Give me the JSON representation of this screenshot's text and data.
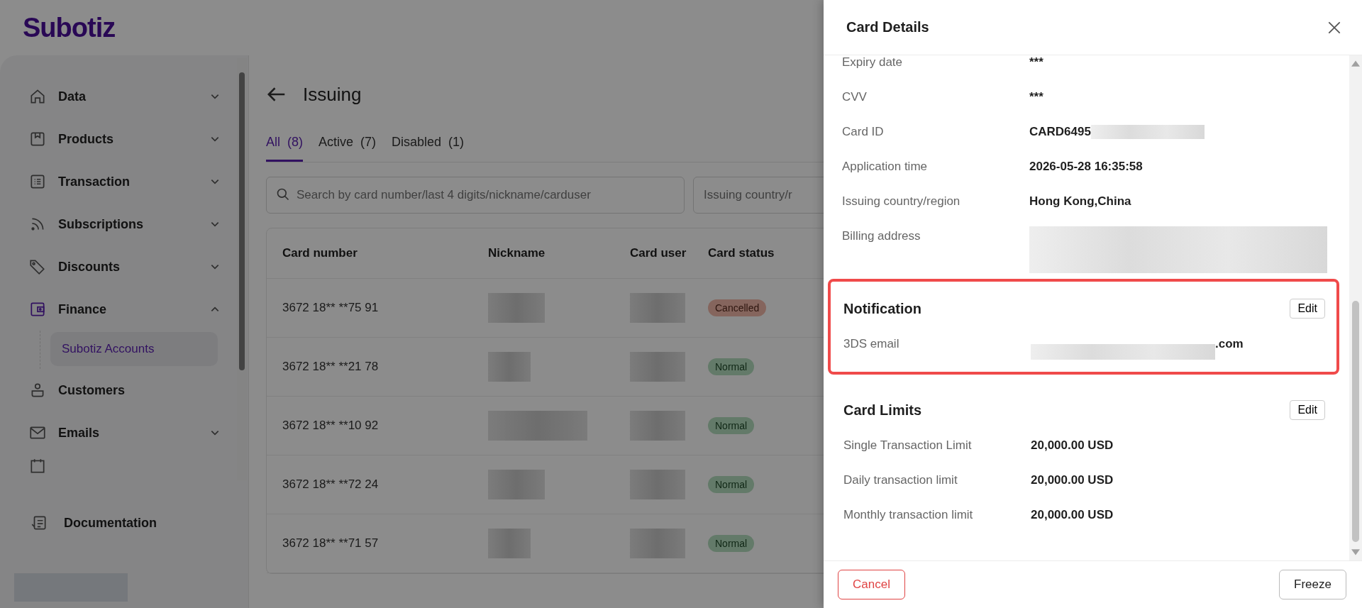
{
  "app": {
    "logo": "Subotiz"
  },
  "sidebar": {
    "items": [
      {
        "label": "Data",
        "expandable": true,
        "expanded": false,
        "selected": false
      },
      {
        "label": "Products",
        "expandable": true,
        "expanded": false,
        "selected": false
      },
      {
        "label": "Transaction",
        "expandable": true,
        "expanded": false,
        "selected": false
      },
      {
        "label": "Subscriptions",
        "expandable": true,
        "expanded": false,
        "selected": false
      },
      {
        "label": "Discounts",
        "expandable": true,
        "expanded": false,
        "selected": false
      },
      {
        "label": "Finance",
        "expandable": true,
        "expanded": true,
        "selected": true,
        "children": [
          {
            "label": "Subotiz Accounts",
            "selected": true
          }
        ]
      },
      {
        "label": "Customers",
        "expandable": false,
        "expanded": false,
        "selected": false
      },
      {
        "label": "Emails",
        "expandable": true,
        "expanded": false,
        "selected": false
      }
    ],
    "footer_item": {
      "label": "Documentation"
    }
  },
  "page": {
    "title": "Issuing",
    "tabs": [
      {
        "label": "All",
        "count": "(8)",
        "selected": true
      },
      {
        "label": "Active",
        "count": "(7)",
        "selected": false
      },
      {
        "label": "Disabled",
        "count": "(1)",
        "selected": false
      }
    ],
    "search": {
      "placeholder": "Search by card number/last 4 digits/nickname/carduser"
    },
    "filter": {
      "placeholder": "Issuing country/r"
    },
    "table": {
      "columns": [
        "Card number",
        "Nickname",
        "Card user",
        "Card status"
      ],
      "rows": [
        {
          "card_number": "3672 18** **75 91",
          "status": "Cancelled",
          "kind": "cancelled"
        },
        {
          "card_number": "3672 18** **21 78",
          "status": "Normal",
          "kind": "normal"
        },
        {
          "card_number": "3672 18** **10 92",
          "status": "Normal",
          "kind": "normal"
        },
        {
          "card_number": "3672 18** **72 24",
          "status": "Normal",
          "kind": "normal"
        },
        {
          "card_number": "3672 18** **71 57",
          "status": "Normal",
          "kind": "normal"
        }
      ]
    }
  },
  "drawer": {
    "title": "Card Details",
    "details": [
      {
        "label": "Expiry date",
        "value": "***",
        "kind": "plain"
      },
      {
        "label": "CVV",
        "value": "***",
        "kind": "plain"
      },
      {
        "label": "Card ID",
        "value": "CARD6495",
        "kind": "redacted-after"
      },
      {
        "label": "Application time",
        "value": "2026-05-28 16:35:58",
        "kind": "plain"
      },
      {
        "label": "Issuing country/region",
        "value": "Hong Kong,China",
        "kind": "plain"
      },
      {
        "label": "Billing address",
        "kind": "redacted-block"
      }
    ],
    "sections": [
      {
        "title": "Notification",
        "action": "Edit",
        "highlighted": true,
        "fields": [
          {
            "label": "3DS email",
            "value": ".com",
            "kind": "redacted-before"
          }
        ]
      },
      {
        "title": "Card Limits",
        "action": "Edit",
        "highlighted": false,
        "fields": [
          {
            "label": "Single Transaction Limit",
            "value": "20,000.00 USD",
            "kind": "plain"
          },
          {
            "label": "Daily transaction limit",
            "value": "20,000.00 USD",
            "kind": "plain"
          },
          {
            "label": "Monthly transaction limit",
            "value": "20,000.00 USD",
            "kind": "plain"
          }
        ]
      }
    ],
    "buttons": [
      {
        "label": "Cancel",
        "kind": "danger"
      },
      {
        "label": "Freeze",
        "kind": "default"
      }
    ]
  }
}
